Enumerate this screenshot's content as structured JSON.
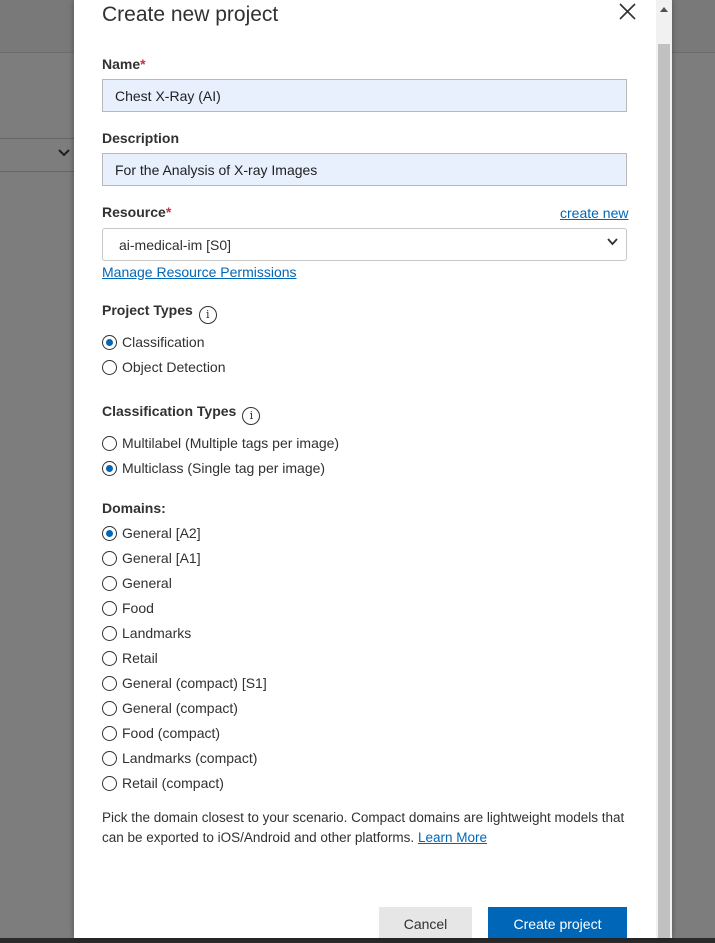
{
  "background": {
    "select_chevron": "⌄"
  },
  "dialog": {
    "title": "Create new project",
    "name": {
      "label": "Name",
      "required_mark": "*",
      "value": "Chest X-Ray (AI)"
    },
    "description": {
      "label": "Description",
      "value": "For the Analysis of X-ray Images"
    },
    "resource": {
      "label": "Resource",
      "required_mark": "*",
      "create_link": "create new",
      "selected": "ai-medical-im [S0]",
      "permissions_link": "Manage Resource Permissions"
    },
    "project_types": {
      "label": "Project Types",
      "info": "i",
      "options": [
        {
          "label": "Classification",
          "checked": true
        },
        {
          "label": "Object Detection",
          "checked": false
        }
      ]
    },
    "classification_types": {
      "label": "Classification Types",
      "info": "i",
      "options": [
        {
          "label": "Multilabel (Multiple tags per image)",
          "checked": false
        },
        {
          "label": "Multiclass (Single tag per image)",
          "checked": true
        }
      ]
    },
    "domains": {
      "label": "Domains:",
      "options": [
        {
          "label": "General [A2]",
          "checked": true
        },
        {
          "label": "General [A1]",
          "checked": false
        },
        {
          "label": "General",
          "checked": false
        },
        {
          "label": "Food",
          "checked": false
        },
        {
          "label": "Landmarks",
          "checked": false
        },
        {
          "label": "Retail",
          "checked": false
        },
        {
          "label": "General (compact) [S1]",
          "checked": false
        },
        {
          "label": "General (compact)",
          "checked": false
        },
        {
          "label": "Food (compact)",
          "checked": false
        },
        {
          "label": "Landmarks (compact)",
          "checked": false
        },
        {
          "label": "Retail (compact)",
          "checked": false
        }
      ]
    },
    "help_text": "Pick the domain closest to your scenario. Compact domains are lightweight models that can be exported to iOS/Android and other platforms.",
    "learn_more": "Learn More",
    "cancel_label": "Cancel",
    "create_label": "Create project"
  },
  "colors": {
    "accent": "#0067b8",
    "required": "#c4314b",
    "field_fill": "#e8f0fe",
    "overlay": "#7d7d7d"
  }
}
